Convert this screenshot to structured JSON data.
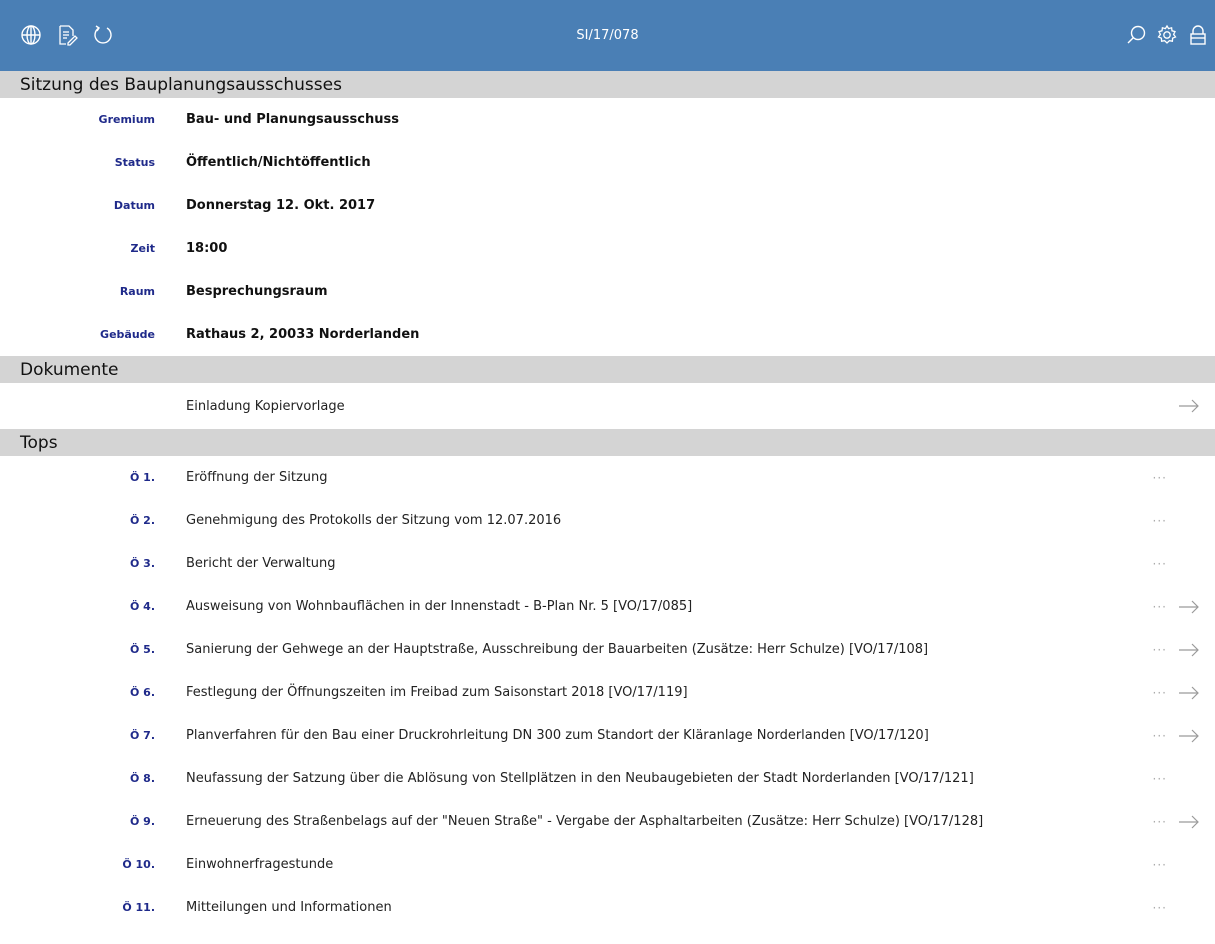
{
  "header": {
    "title": "SI/17/078",
    "left_icons": [
      "globe-icon",
      "document-edit-icon",
      "refresh-icon"
    ],
    "right_icons": [
      "search-icon",
      "gear-icon",
      "lock-icon"
    ],
    "accent": "#4a7fb5"
  },
  "meeting": {
    "section_title": "Sitzung des Bauplanungsausschusses",
    "fields": [
      {
        "label": "Gremium",
        "value": "Bau- und Planungsausschuss"
      },
      {
        "label": "Status",
        "value": "Öffentlich/Nichtöffentlich"
      },
      {
        "label": "Datum",
        "value": "Donnerstag 12. Okt. 2017"
      },
      {
        "label": "Zeit",
        "value": "18:00"
      },
      {
        "label": "Raum",
        "value": "Besprechungsraum"
      },
      {
        "label": "Gebäude",
        "value": "Rathaus 2, 20033 Norderlanden"
      }
    ]
  },
  "documents": {
    "section_title": "Dokumente",
    "items": [
      {
        "label": "Einladung Kopiervorlage",
        "has_arrow": true
      }
    ]
  },
  "tops": {
    "section_title": "Tops",
    "items": [
      {
        "num": "Ö 1.",
        "text": "Eröffnung der Sitzung",
        "dots": "···",
        "has_arrow": false
      },
      {
        "num": "Ö 2.",
        "text": "Genehmigung des Protokolls der Sitzung vom 12.07.2016",
        "dots": "···",
        "has_arrow": false
      },
      {
        "num": "Ö 3.",
        "text": "Bericht der Verwaltung",
        "dots": "···",
        "has_arrow": false
      },
      {
        "num": "Ö 4.",
        "text": "Ausweisung von Wohnbauflächen in der Innenstadt - B-Plan Nr. 5 [VO/17/085]",
        "dots": "···",
        "has_arrow": true
      },
      {
        "num": "Ö 5.",
        "text": "Sanierung der Gehwege an der Hauptstraße, Ausschreibung der Bauarbeiten (Zusätze: Herr Schulze) [VO/17/108]",
        "dots": "···",
        "has_arrow": true
      },
      {
        "num": "Ö 6.",
        "text": "Festlegung der Öffnungszeiten im Freibad zum Saisonstart 2018 [VO/17/119]",
        "dots": "···",
        "has_arrow": true
      },
      {
        "num": "Ö 7.",
        "text": "Planverfahren für den Bau einer Druckrohrleitung DN 300 zum Standort der Kläranlage Norderlanden [VO/17/120]",
        "dots": "···",
        "has_arrow": true
      },
      {
        "num": "Ö 8.",
        "text": "Neufassung der Satzung über die Ablösung von Stellplätzen in den Neubaugebieten der Stadt Norderlanden [VO/17/121]",
        "dots": "···",
        "has_arrow": false
      },
      {
        "num": "Ö 9.",
        "text": "Erneuerung des Straßenbelags auf der \"Neuen Straße\" - Vergabe der Asphaltarbeiten (Zusätze: Herr Schulze) [VO/17/128]",
        "dots": "···",
        "has_arrow": true
      },
      {
        "num": "Ö 10.",
        "text": "Einwohnerfragestunde",
        "dots": "···",
        "has_arrow": false
      },
      {
        "num": "Ö 11.",
        "text": "Mitteilungen und Informationen",
        "dots": "···",
        "has_arrow": false
      }
    ]
  }
}
